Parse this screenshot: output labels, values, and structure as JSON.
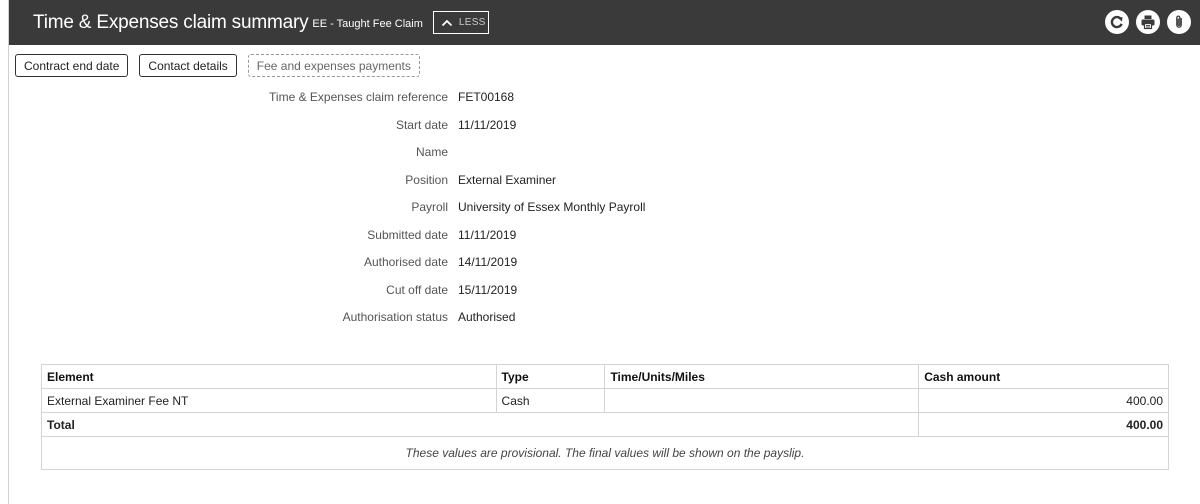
{
  "header": {
    "title": "Time & Expenses claim summary",
    "subtitle": "EE - Taught Fee Claim",
    "less_label": "LESS",
    "icons": [
      "refresh-icon",
      "print-icon",
      "attachment-icon"
    ]
  },
  "tabs": [
    {
      "label": "Contract end date"
    },
    {
      "label": "Contact details"
    },
    {
      "label": "Fee and expenses payments"
    }
  ],
  "details": [
    {
      "label": "Time & Expenses claim reference",
      "value": "FET00168"
    },
    {
      "label": "Start date",
      "value": "11/11/2019"
    },
    {
      "label": "Name",
      "value": ""
    },
    {
      "label": "Position",
      "value": "External Examiner"
    },
    {
      "label": "Payroll",
      "value": "University of Essex Monthly Payroll"
    },
    {
      "label": "Submitted date",
      "value": "11/11/2019"
    },
    {
      "label": "Authorised date",
      "value": "14/11/2019"
    },
    {
      "label": "Cut off date",
      "value": "15/11/2019"
    },
    {
      "label": "Authorisation status",
      "value": "Authorised"
    }
  ],
  "table": {
    "headers": [
      "Element",
      "Type",
      "Time/Units/Miles",
      "Cash amount"
    ],
    "rows": [
      {
        "element": "External Examiner Fee NT",
        "type": "Cash",
        "units": "",
        "cash": "400.00"
      }
    ],
    "total_label": "Total",
    "total_value": "400.00",
    "note": "These values are provisional. The final values will be shown on the payslip."
  },
  "colors": {
    "header_bg": "#3a3a3a",
    "header_text": "#ffffff"
  }
}
